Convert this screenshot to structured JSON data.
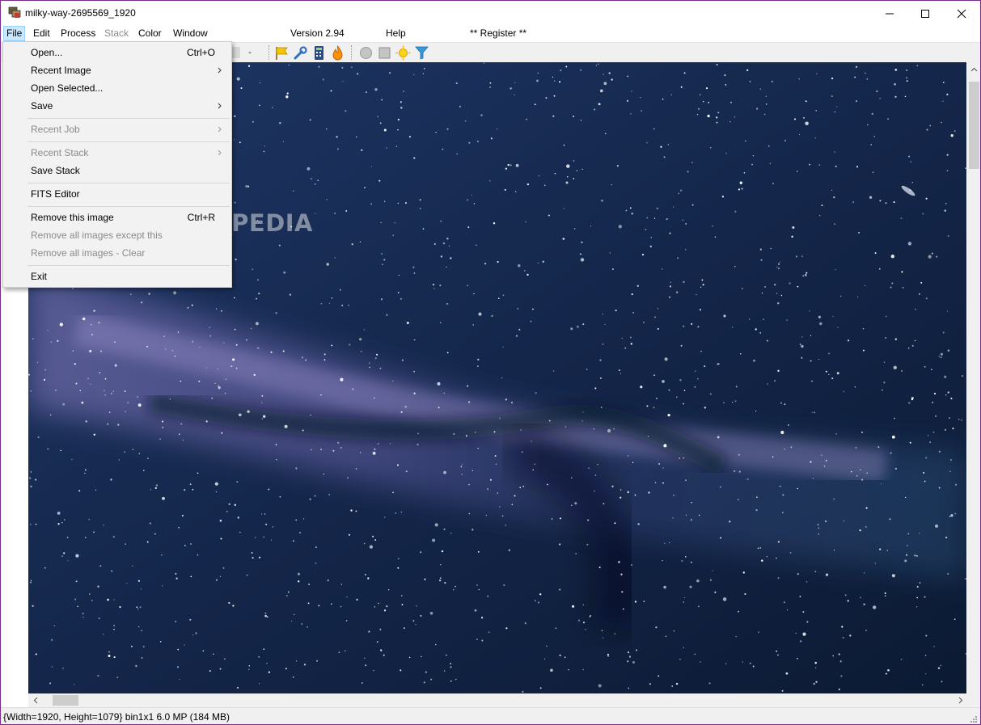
{
  "window": {
    "title": "milky-way-2695569_1920"
  },
  "menubar": {
    "items": [
      {
        "label": "File",
        "state": "active"
      },
      {
        "label": "Edit",
        "state": "normal"
      },
      {
        "label": "Process",
        "state": "normal"
      },
      {
        "label": "Stack",
        "state": "disabled"
      },
      {
        "label": "Color",
        "state": "normal"
      },
      {
        "label": "Window",
        "state": "normal"
      },
      {
        "label": "Version 2.94",
        "state": "normal"
      },
      {
        "label": "Help",
        "state": "normal"
      },
      {
        "label": "** Register **",
        "state": "normal"
      }
    ]
  },
  "toolbar": {
    "icons": [
      "flag-icon",
      "wrench-icon",
      "calculator-icon",
      "flame-icon",
      "circle-icon",
      "square-icon",
      "sun-icon",
      "filter-icon"
    ]
  },
  "file_menu": {
    "items": [
      {
        "label": "Open...",
        "shortcut": "Ctrl+O",
        "submenu": false,
        "disabled": false
      },
      {
        "label": "Recent Image",
        "shortcut": "",
        "submenu": true,
        "disabled": false
      },
      {
        "label": "Open Selected...",
        "shortcut": "",
        "submenu": false,
        "disabled": false
      },
      {
        "label": "Save",
        "shortcut": "",
        "submenu": true,
        "disabled": false
      },
      {
        "label": "Recent Job",
        "shortcut": "",
        "submenu": true,
        "disabled": true
      },
      {
        "label": "Recent Stack",
        "shortcut": "",
        "submenu": true,
        "disabled": true
      },
      {
        "label": "Save Stack",
        "shortcut": "",
        "submenu": false,
        "disabled": false
      },
      {
        "label": "FITS Editor",
        "shortcut": "",
        "submenu": false,
        "disabled": false
      },
      {
        "label": "Remove this image",
        "shortcut": "Ctrl+R",
        "submenu": false,
        "disabled": false
      },
      {
        "label": "Remove all images except this",
        "shortcut": "",
        "submenu": false,
        "disabled": true
      },
      {
        "label": "Remove all images - Clear",
        "shortcut": "",
        "submenu": false,
        "disabled": true
      },
      {
        "label": "Exit",
        "shortcut": "",
        "submenu": false,
        "disabled": false
      }
    ]
  },
  "watermark": "SOFTPEDIA",
  "statusbar": {
    "text": "{Width=1920, Height=1079} bin1x1  6.0 MP (184 MB)"
  },
  "colors": {
    "menu_highlight": "#cce8ff",
    "sky_dark": "#0e1a2c",
    "window_border": "#7b2c8a"
  }
}
